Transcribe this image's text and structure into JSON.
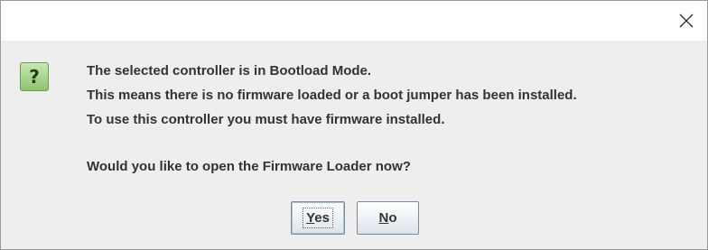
{
  "dialog": {
    "close_icon": "close-icon",
    "icon": {
      "name": "question-icon",
      "glyph": "?",
      "color": "#8fc46e"
    },
    "message_lines": [
      "The selected controller is in Bootload Mode.",
      "This means there is no firmware loaded or a boot jumper has been installed.",
      "To use this controller you must have firmware installed."
    ],
    "question": "Would you like to open the Firmware Loader now?",
    "buttons": {
      "yes": {
        "mnemonic": "Y",
        "rest": "es"
      },
      "no": {
        "mnemonic": "N",
        "rest": "o"
      }
    }
  }
}
